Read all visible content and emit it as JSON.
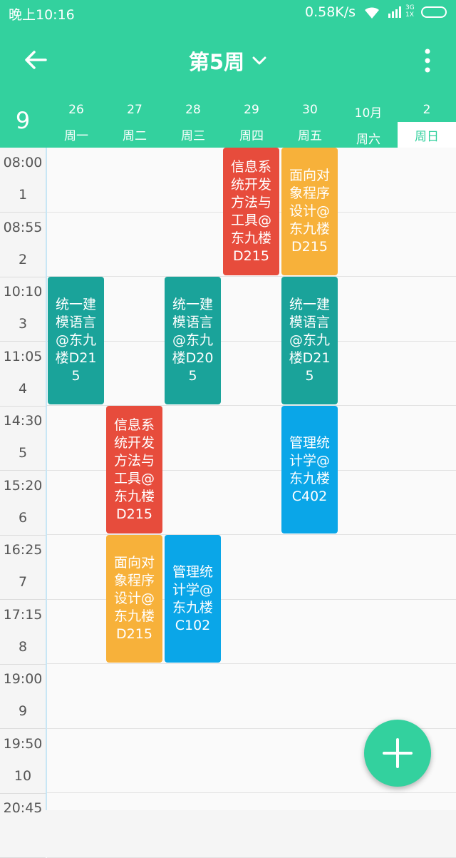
{
  "status_bar": {
    "time": "晚上10:16",
    "speed": "0.58K/s",
    "network": "3G\n1X",
    "icons": [
      "wifi-icon",
      "signal-icon",
      "battery-icon"
    ]
  },
  "header": {
    "title": "第5周",
    "month": "9",
    "colors": {
      "primary": "#33d19e"
    }
  },
  "days": [
    {
      "num": "26",
      "name": "周一"
    },
    {
      "num": "27",
      "name": "周二"
    },
    {
      "num": "28",
      "name": "周三"
    },
    {
      "num": "29",
      "name": "周四"
    },
    {
      "num": "30",
      "name": "周五"
    },
    {
      "num": "10月",
      "name": "周六"
    },
    {
      "num": "2",
      "name": "周日"
    }
  ],
  "periods": [
    {
      "time": "08:00",
      "num": "1"
    },
    {
      "time": "08:55",
      "num": "2"
    },
    {
      "time": "10:10",
      "num": "3"
    },
    {
      "time": "11:05",
      "num": "4"
    },
    {
      "time": "14:30",
      "num": "5"
    },
    {
      "time": "15:20",
      "num": "6"
    },
    {
      "time": "16:25",
      "num": "7"
    },
    {
      "time": "17:15",
      "num": "8"
    },
    {
      "time": "19:00",
      "num": "9"
    },
    {
      "time": "19:50",
      "num": "10"
    },
    {
      "time": "20:45",
      "num": ""
    }
  ],
  "courses": [
    {
      "text": "信息系统开发方法与工具@东九楼D215",
      "day": 4,
      "start": 1,
      "span": 2,
      "color": "#e74c3c"
    },
    {
      "text": "面向对象程序设计@东九楼D215",
      "day": 5,
      "start": 1,
      "span": 2,
      "color": "#f7b13a"
    },
    {
      "text": "统一建模语言@东九楼D215",
      "day": 1,
      "start": 3,
      "span": 2,
      "color": "#1aa39a"
    },
    {
      "text": "统一建模语言@东九楼D205",
      "day": 3,
      "start": 3,
      "span": 2,
      "color": "#1aa39a"
    },
    {
      "text": "统一建模语言@东九楼D215",
      "day": 5,
      "start": 3,
      "span": 2,
      "color": "#1aa39a"
    },
    {
      "text": "信息系统开发方法与工具@东九楼D215",
      "day": 2,
      "start": 5,
      "span": 2,
      "color": "#e74c3c"
    },
    {
      "text": "管理统计学@东九楼C402",
      "day": 5,
      "start": 5,
      "span": 2,
      "color": "#0aa6e8"
    },
    {
      "text": "面向对象程序设计@东九楼D215",
      "day": 2,
      "start": 7,
      "span": 2,
      "color": "#f7b13a"
    },
    {
      "text": "管理统计学@东九楼C102",
      "day": 3,
      "start": 7,
      "span": 2,
      "color": "#0aa6e8"
    }
  ],
  "fab": {
    "icon": "plus-icon"
  }
}
